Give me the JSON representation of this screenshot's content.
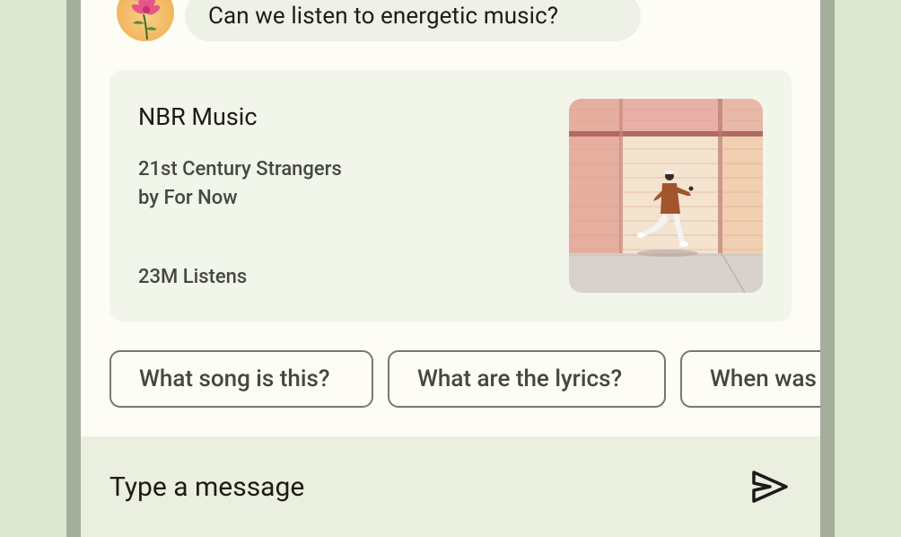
{
  "conversation": {
    "user_message": "Can we listen to energetic music?"
  },
  "music_card": {
    "app_name": "NBR Music",
    "song_title": "21st Century Strangers",
    "song_artist": "by For Now",
    "listens": "23M Listens"
  },
  "suggestions": [
    {
      "label": "What song is this?"
    },
    {
      "label": "What are the lyrics?"
    },
    {
      "label": "When was"
    }
  ],
  "composer": {
    "placeholder": "Type a message",
    "send_icon": "send-icon"
  },
  "colors": {
    "background": "#dbe8cf",
    "surface": "#fdfdf5",
    "card": "#f1f5ea",
    "bubble": "#eef2e6",
    "composer": "#eaefdf",
    "outline": "#74796d"
  }
}
